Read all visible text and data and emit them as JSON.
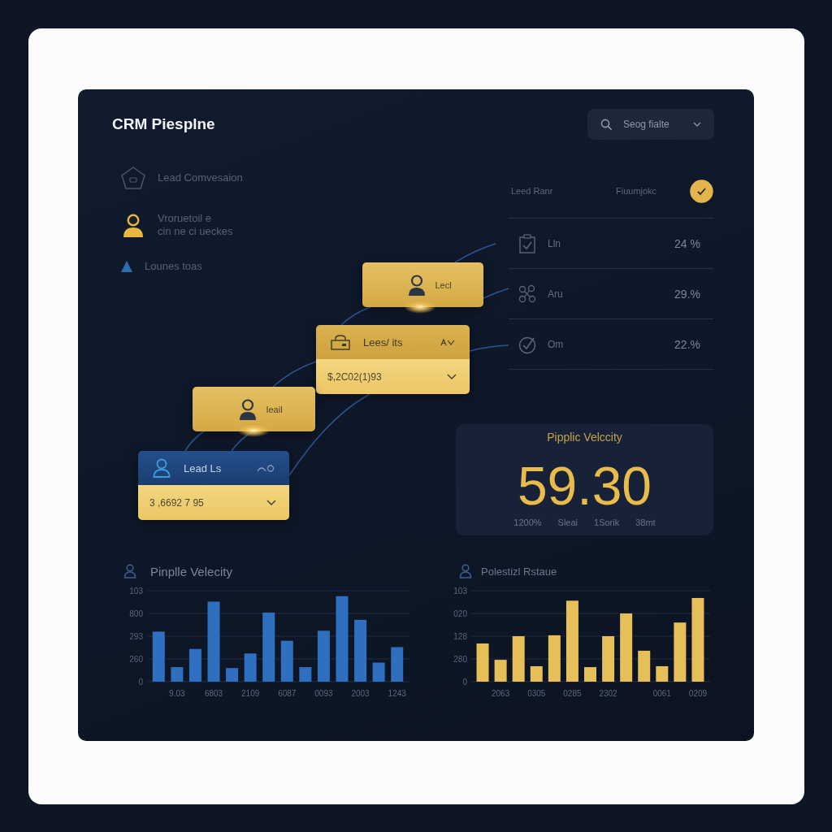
{
  "window": {
    "title": "CRM Piesplne"
  },
  "filter_dropdown": {
    "value": "Seog fialte"
  },
  "sidebar": {
    "items": [
      {
        "lines": [
          "Lead Comvesaion"
        ],
        "selected": false
      },
      {
        "lines": [
          "Vroruetoil e",
          "cin ne ci ueckes"
        ],
        "selected": true
      },
      {
        "lines": [
          "Lounes toas"
        ],
        "selected": false
      }
    ]
  },
  "table": {
    "columns": [
      "Leed Ranr",
      "Fiuumjokc"
    ],
    "checked": true,
    "rows": [
      {
        "name": "Lln",
        "value": "24 %"
      },
      {
        "name": "Aru",
        "value": "29.%"
      },
      {
        "name": "Om",
        "value": "22.%"
      }
    ]
  },
  "pipeline_cards": [
    {
      "kind": "single",
      "label": "Lecl",
      "selected": false
    },
    {
      "kind": "double",
      "label": "Lees/ its",
      "amount": "$,2C02(1)93",
      "selected": false
    },
    {
      "kind": "single",
      "label": "Ieail",
      "selected": false
    },
    {
      "kind": "double",
      "label": "Lead Ls",
      "amount": "3 ,6692 7 95",
      "selected": true
    }
  ],
  "velocity_panel": {
    "title": "Pipplic Velccity",
    "value": "59.30",
    "stats": [
      "1200%",
      "Sleai",
      "1Sorik",
      "38mt"
    ]
  },
  "charts": [
    {
      "title": "Pinplle Velecity",
      "color": "#2f6fbf",
      "y_labels": [
        "103",
        "800",
        "293",
        "260",
        "0"
      ],
      "x_labels": [
        "9.03",
        "6803",
        "2109",
        "6087",
        "0093",
        "2003",
        "1243"
      ]
    },
    {
      "title": "Polestizl Rstaue",
      "color": "#e6bf58",
      "y_labels": [
        "103",
        "020",
        "128",
        "280",
        "0"
      ],
      "x_labels": [
        "2063",
        "0305",
        "0285",
        "2302",
        "0061",
        "0209"
      ]
    }
  ]
}
